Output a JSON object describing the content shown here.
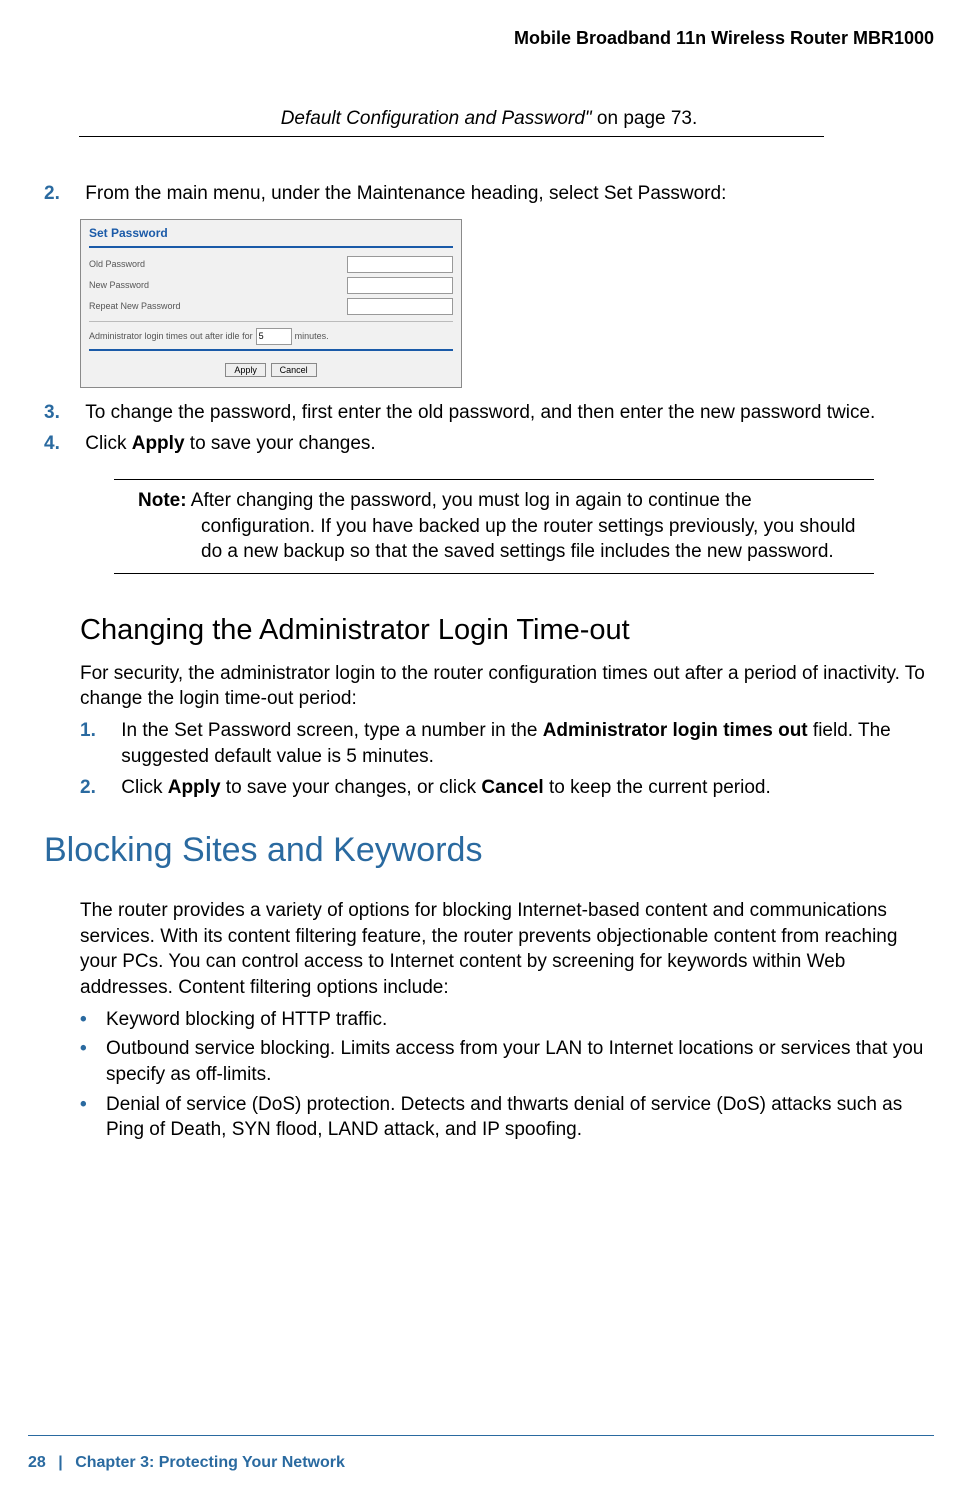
{
  "header": {
    "title": "Mobile Broadband 11n Wireless Router MBR1000"
  },
  "ref": {
    "italic": "Default Configuration and Password\"",
    "rest": " on page 73."
  },
  "steps_a": [
    {
      "num": "2.",
      "text": "From the main menu, under the Maintenance heading, select Set Password:"
    }
  ],
  "screenshot": {
    "title": "Set Password",
    "old_pw_label": "Old Password",
    "new_pw_label": "New Password",
    "repeat_pw_label": "Repeat New Password",
    "timeout_prefix": "Administrator login times out after idle for",
    "timeout_value": "5",
    "timeout_suffix": "minutes.",
    "apply": "Apply",
    "cancel": "Cancel"
  },
  "steps_b": [
    {
      "num": "3.",
      "text": "To change the password, first enter the old password, and then enter the new password twice."
    },
    {
      "num": "4.",
      "pre": "Click ",
      "bold": "Apply",
      "post": " to save your changes."
    }
  ],
  "note": {
    "label": "Note:",
    "first_line": "After changing the password, you must log in again to continue the",
    "rest": "configuration. If you have backed up the router settings previously, you should do a new backup so that the saved settings file includes the new password."
  },
  "h2_timeout": "Changing the Administrator Login Time-out",
  "timeout_intro": "For security, the administrator login to the router configuration times out after a period of inactivity. To change the login time-out period:",
  "timeout_steps": [
    {
      "num": "1.",
      "pre": "In the Set Password screen, type a number in the ",
      "bold": "Administrator login times out",
      "post": " field. The suggested default value is 5 minutes."
    },
    {
      "num": "2.",
      "pre": "Click ",
      "bold": "Apply",
      "mid": " to save your changes, or click ",
      "bold2": "Cancel",
      "post": " to keep the current period."
    }
  ],
  "h1_block": "Blocking Sites and Keywords",
  "block_intro": "The router provides a variety of options for blocking Internet-based content and communications services. With its content filtering feature, the router prevents objectionable content from reaching your PCs. You can control access to Internet content by screening for keywords within Web addresses. Content filtering options include:",
  "bullets": [
    "Keyword blocking of HTTP traffic.",
    "Outbound service blocking. Limits access from your LAN to Internet locations or services that you specify as off-limits.",
    "Denial of service (DoS) protection. Detects and thwarts denial of service (DoS) attacks such as Ping of Death, SYN flood, LAND attack, and IP spoofing."
  ],
  "footer": {
    "page": "28",
    "sep": "|",
    "chapter": "Chapter 3:  Protecting Your Network"
  }
}
